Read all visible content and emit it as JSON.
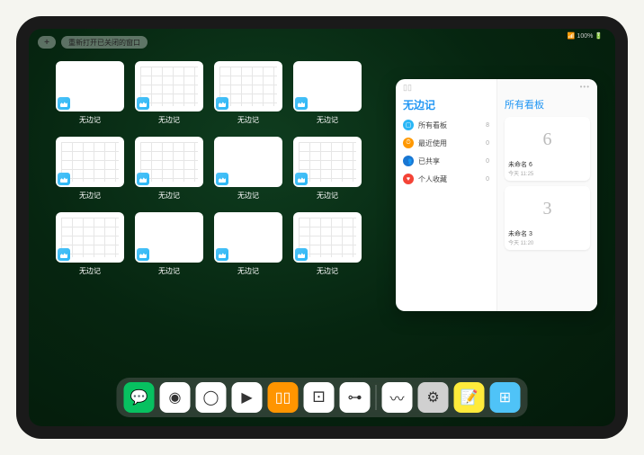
{
  "status": {
    "text": "📶 100% 🔋"
  },
  "topbar": {
    "plus": "+",
    "pill_label": "重新打开已关闭的窗口"
  },
  "app_label": "无边记",
  "cards": [
    {
      "label": "无边记",
      "variant": "blank"
    },
    {
      "label": "无边记",
      "variant": "grid"
    },
    {
      "label": "无边记",
      "variant": "grid"
    },
    {
      "label": "无边记",
      "variant": "blank"
    },
    {
      "label": "无边记",
      "variant": "grid"
    },
    {
      "label": "无边记",
      "variant": "grid"
    },
    {
      "label": "无边记",
      "variant": "blank"
    },
    {
      "label": "无边记",
      "variant": "grid"
    },
    {
      "label": "无边记",
      "variant": "grid"
    },
    {
      "label": "无边记",
      "variant": "blank"
    },
    {
      "label": "无边记",
      "variant": "blank"
    },
    {
      "label": "无边记",
      "variant": "grid"
    }
  ],
  "panel": {
    "left_title": "无边记",
    "right_title": "所有看板",
    "rows": [
      {
        "icon_color": "#29b6f6",
        "glyph": "▢",
        "label": "所有看板",
        "count": "8"
      },
      {
        "icon_color": "#ff9800",
        "glyph": "⏱",
        "label": "最近使用",
        "count": "0"
      },
      {
        "icon_color": "#1976d2",
        "glyph": "👥",
        "label": "已共享",
        "count": "0"
      },
      {
        "icon_color": "#f44336",
        "glyph": "♥",
        "label": "个人收藏",
        "count": "0"
      }
    ],
    "boards": [
      {
        "sketch": "6",
        "name": "未命名 6",
        "sub": "今天 11:25"
      },
      {
        "sketch": "3",
        "name": "未命名 3",
        "sub": "今天 11:20"
      }
    ]
  },
  "dock": [
    {
      "name": "wechat-icon",
      "bg": "#07c160",
      "glyph": "💬"
    },
    {
      "name": "quark-icon",
      "bg": "#ffffff",
      "glyph": "◉"
    },
    {
      "name": "qqbrowser-icon",
      "bg": "#ffffff",
      "glyph": "◯"
    },
    {
      "name": "play-icon",
      "bg": "#ffffff",
      "glyph": "▶"
    },
    {
      "name": "books-icon",
      "bg": "#ff9500",
      "glyph": "▯▯"
    },
    {
      "name": "dice-icon",
      "bg": "#ffffff",
      "glyph": "⚀"
    },
    {
      "name": "connect-icon",
      "bg": "#ffffff",
      "glyph": "⊶"
    },
    {
      "name": "freeform-icon",
      "bg": "#ffffff",
      "glyph": "〰"
    },
    {
      "name": "settings-icon",
      "bg": "#d0d0d0",
      "glyph": "⚙"
    },
    {
      "name": "notes-icon",
      "bg": "#ffeb3b",
      "glyph": "📝"
    },
    {
      "name": "apps-icon",
      "bg": "#4fc3f7",
      "glyph": "⊞"
    }
  ]
}
